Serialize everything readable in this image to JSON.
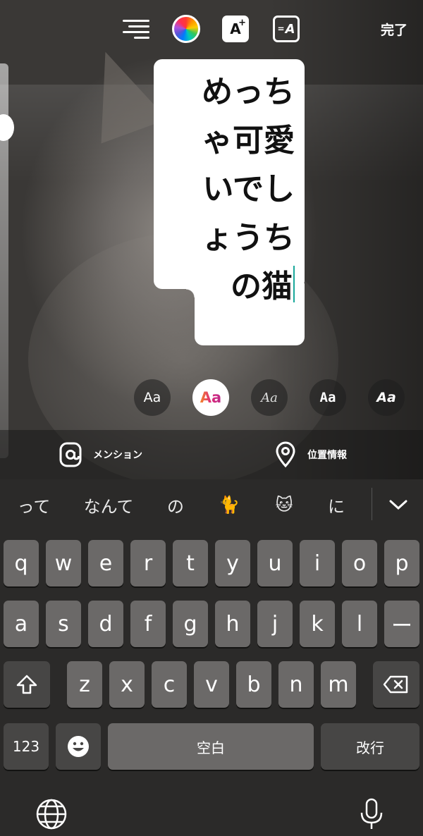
{
  "toolbar": {
    "align_icon": "text-align-icon",
    "color_icon": "color-wheel-icon",
    "effects_label": "A",
    "effects_sup": "+",
    "style_label": "A",
    "done_label": "完了"
  },
  "sticker": {
    "lines": [
      "めっち",
      "ゃ可愛",
      "いでし",
      "ょうち",
      "の猫"
    ]
  },
  "fonts": {
    "items": [
      "Aa",
      "Aa",
      "Aa",
      "Aa",
      "Aa"
    ],
    "selected_index": 1
  },
  "tag_bar": {
    "mention_label": "メンション",
    "location_label": "位置情報"
  },
  "keyboard": {
    "suggestions": [
      "って",
      "なんて",
      "の",
      "🐈",
      "🐱",
      "に"
    ],
    "row1": [
      "q",
      "w",
      "e",
      "r",
      "t",
      "y",
      "u",
      "i",
      "o",
      "p"
    ],
    "row2": [
      "a",
      "s",
      "d",
      "f",
      "g",
      "h",
      "j",
      "k",
      "l",
      "ー"
    ],
    "row3": [
      "z",
      "x",
      "c",
      "v",
      "b",
      "n",
      "m"
    ],
    "numbers_key": "123",
    "space_key": "空白",
    "return_key": "改行"
  },
  "colors": {
    "keyboard_bg": "#2b2a29",
    "key": "#6b6968",
    "key_dark": "#474645",
    "cursor": "#19a89a"
  }
}
